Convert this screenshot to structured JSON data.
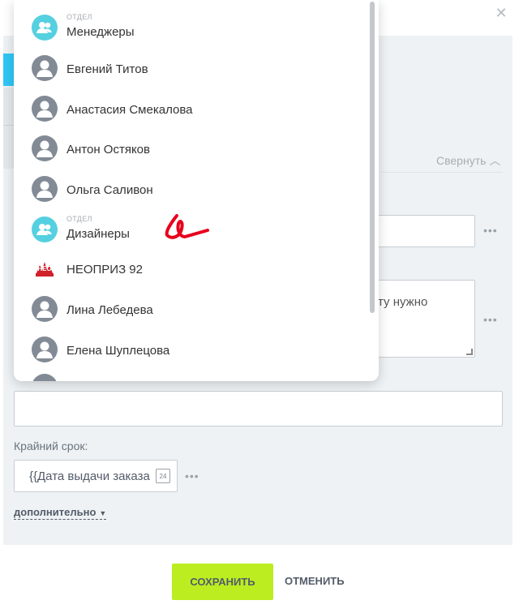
{
  "popup": {
    "items": [
      {
        "kind": "ОТДЕЛ",
        "name": "Менеджеры",
        "type": "department"
      },
      {
        "kind": "",
        "name": "Евгений Титов",
        "type": "user"
      },
      {
        "kind": "",
        "name": "Анастасия Смекалова",
        "type": "user"
      },
      {
        "kind": "",
        "name": "Антон Остяков",
        "type": "user"
      },
      {
        "kind": "",
        "name": "Ольга Саливон",
        "type": "user"
      },
      {
        "kind": "ОТДЕЛ",
        "name": "Дизайнеры",
        "type": "department"
      },
      {
        "kind": "",
        "name": "НЕОПРИЗ 92",
        "type": "company",
        "logo_text": "НЕО"
      },
      {
        "kind": "",
        "name": "Лина Лебедева",
        "type": "user"
      },
      {
        "kind": "",
        "name": "Елена Шуплецова",
        "type": "user"
      }
    ]
  },
  "form": {
    "collapse_label": "Свернуть",
    "textarea_value_fragment": "ту нужно",
    "deadline_label": "Крайний срок:",
    "deadline_value": "{{Дата выдачи заказа",
    "calendar_day": "24",
    "additional_label": "дополнительно"
  },
  "buttons": {
    "save": "СОХРАНИТЬ",
    "cancel": "ОТМЕНИТЬ"
  },
  "colors": {
    "accent_blue": "#2fc6f6",
    "save_green": "#bbed21",
    "department_avatar": "#55d0e0",
    "user_avatar": "#828b95",
    "annotation_red": "#e8001c"
  }
}
